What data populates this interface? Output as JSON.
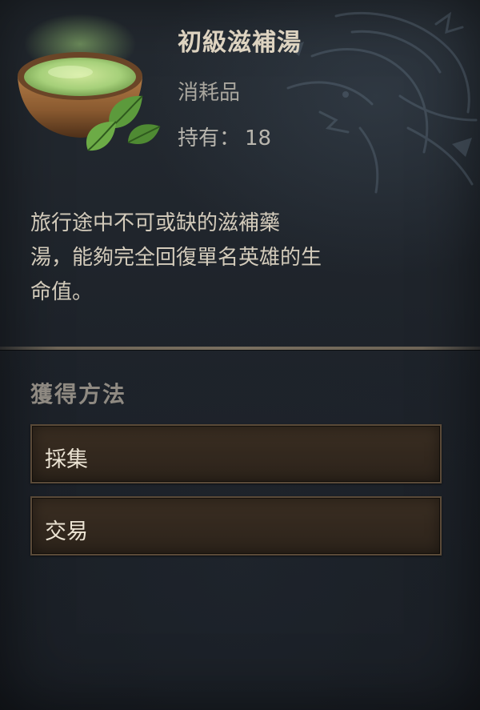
{
  "item": {
    "name": "初級滋補湯",
    "type": "消耗品",
    "owned_label": "持有：",
    "owned_count": "18",
    "icon": "herbal-soup-bowl-icon"
  },
  "description": {
    "lines": [
      "旅行途中不可或缺的滋補藥",
      "湯，能夠完全回復單名英雄的生",
      "命值。"
    ]
  },
  "acquisition": {
    "title": "獲得方法",
    "methods": [
      {
        "label": "採集"
      },
      {
        "label": "交易"
      }
    ]
  },
  "colors": {
    "background": "#1d2229",
    "button_fill": "#33281e",
    "button_border": "#5a4a38",
    "soup_green": "#a6d07a"
  }
}
